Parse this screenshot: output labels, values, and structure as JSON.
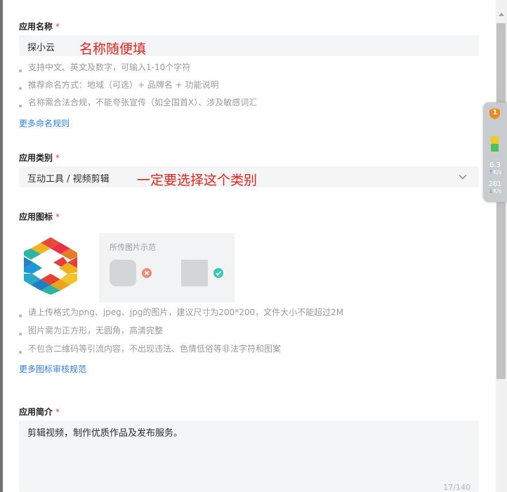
{
  "app_name": {
    "label": "应用名称",
    "required_mark": "*",
    "value": "探小云",
    "annotation": "名称随便填",
    "hints": [
      "支持中文、英文及数字，可输入1-10个字符",
      "推荐命名方式：地域（可选）+ 品牌名 + 功能说明",
      "名称需合法合规，不能夸张宣传（如全国首X）、涉及敏感词汇"
    ],
    "link": "更多命名规则"
  },
  "app_category": {
    "label": "应用类别",
    "required_mark": "*",
    "value": "互动工具 / 视频剪辑",
    "annotation": "一定要选择这个类别"
  },
  "app_icon": {
    "label": "应用图标",
    "required_mark": "*",
    "example_title": "所传图片示范",
    "hints": [
      "请上传格式为png、jpeg、jpg的图片，建议尺寸为200*200，文件大小不能超过2M",
      "图片需为正方形，无圆角，高清完整",
      "不包含二维码等引流内容，不出现违法、色情低俗等非法字符和图案"
    ],
    "link": "更多图标审核规范"
  },
  "app_intro": {
    "label": "应用简介",
    "required_mark": "*",
    "value": "剪辑视频，制作优质作品及发布服务。",
    "counter": "17/140"
  },
  "speed_widget": {
    "badge": "1",
    "upload_value": "6.3",
    "upload_unit": "K/s",
    "download_value": "281",
    "download_unit": "K/s"
  },
  "colors": {
    "required": "#e64340",
    "link": "#2f7fe6",
    "annotation": "#e8231b",
    "input_bg": "#f4f5f6"
  }
}
